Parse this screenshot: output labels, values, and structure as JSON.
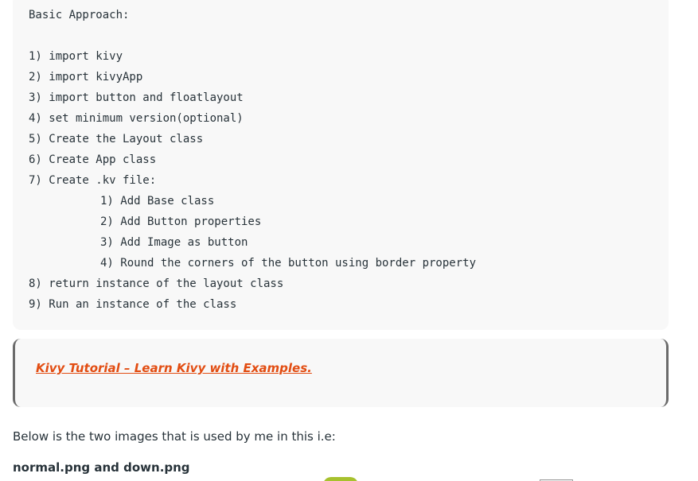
{
  "code_block": {
    "lines": [
      "Basic Approach:",
      "",
      "1) import kivy",
      "2) import kivyApp",
      "3) import button and floatlayout",
      "4) set minimum version(optional)",
      "5) Create the Layout class",
      "6) Create App class",
      "7) Create .kv file:",
      "1) Add Base class",
      "2) Add Button properties",
      "3) Add Image as button",
      "4) Round the corners of the button using border property",
      "8) return instance of the layout class",
      "9) Run an instance of the class"
    ]
  },
  "callout": {
    "link_text": "Kivy Tutorial – Learn Kivy with Examples."
  },
  "body": {
    "paragraph": "Below is the two images that is used by me in this i.e:",
    "files_label": "normal.png and down.png"
  },
  "colors": {
    "link": "#e24d12",
    "code_background": "#f8f8f8",
    "text": "#273239"
  }
}
